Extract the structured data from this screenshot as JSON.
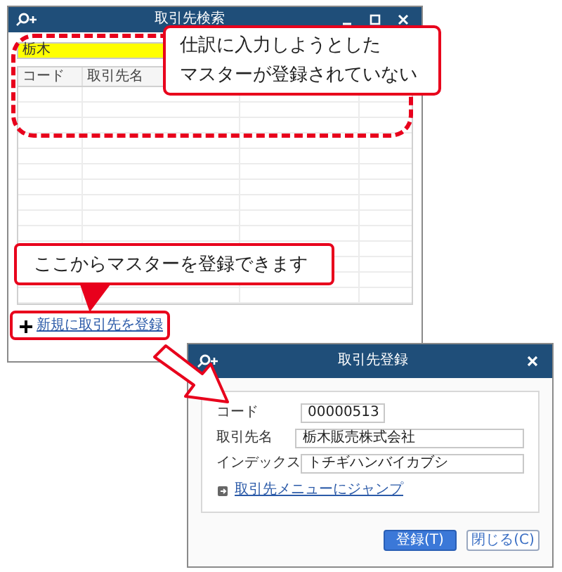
{
  "search_window": {
    "title": "取引先検索",
    "search_value": "栃木",
    "columns": [
      "コード",
      "取引先名"
    ],
    "link": "新規に取引先を登録"
  },
  "callouts": [
    {
      "lines": [
        "仕訳に入力しようとした",
        "マスターが登録されていない"
      ]
    },
    {
      "lines": [
        "ここからマスターを登録できます"
      ]
    }
  ],
  "register_window": {
    "title": "取引先登録",
    "fields": [
      {
        "label": "コード",
        "value": "00000513",
        "kind": "short"
      },
      {
        "label": "取引先名",
        "value": "栃木販売株式会社",
        "kind": "long"
      },
      {
        "label": "インデックス",
        "value": "トチギハンバイカブシ",
        "kind": "long"
      }
    ],
    "link": "取引先メニューにジャンプ",
    "buttons": [
      {
        "label": "登録(T)",
        "kind": "primary"
      },
      {
        "label": "閉じる(C)",
        "kind": "secondary"
      }
    ]
  }
}
